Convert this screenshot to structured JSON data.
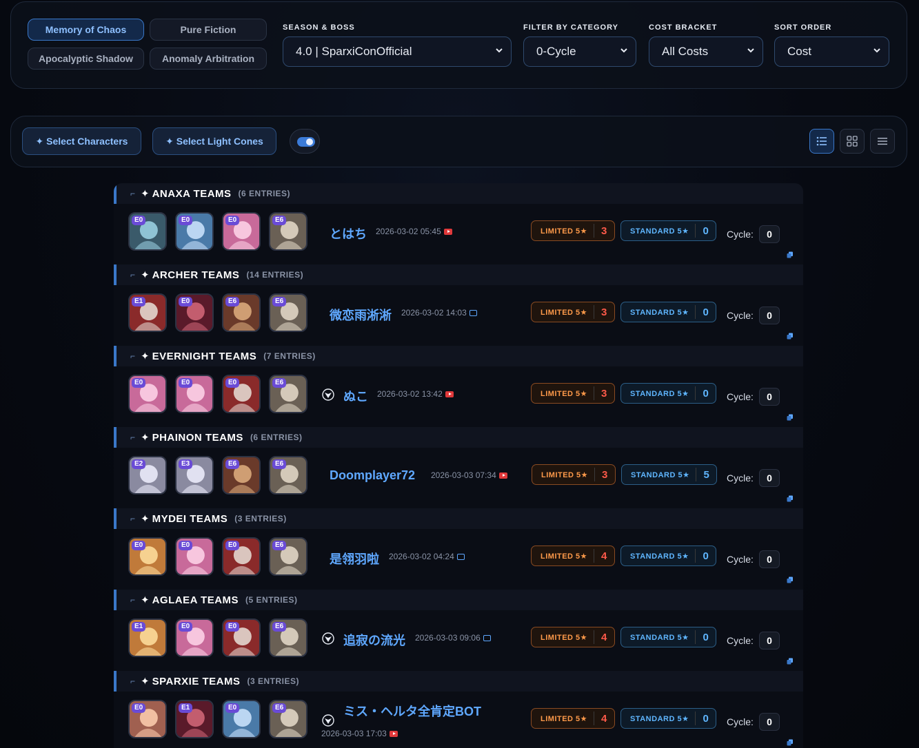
{
  "modes": [
    {
      "label": "Memory of Chaos",
      "active": true
    },
    {
      "label": "Pure Fiction",
      "active": false
    },
    {
      "label": "Apocalyptic Shadow",
      "active": false
    },
    {
      "label": "Anomaly Arbitration",
      "active": false
    }
  ],
  "filters": {
    "season": {
      "label": "SEASON & BOSS",
      "value": "4.0 | SparxiConOfficial"
    },
    "category": {
      "label": "FILTER BY CATEGORY",
      "value": "0-Cycle"
    },
    "cost": {
      "label": "COST BRACKET",
      "value": "All Costs"
    },
    "sort": {
      "label": "SORT ORDER",
      "value": "Cost"
    }
  },
  "toolbar": {
    "select_characters": "✦ Select Characters",
    "select_light_cones": "✦ Select Light Cones",
    "toggle_on": true
  },
  "labels": {
    "limited": "LIMITED 5★",
    "standard": "STANDARD 5★",
    "cycle": "Cycle:"
  },
  "groups": [
    {
      "name": "ANAXA TEAMS",
      "count": "(6 ENTRIES)",
      "entry": {
        "player": "とはち",
        "date": "2026-03-02 05:45",
        "source": "youtube",
        "verified": false,
        "eidolons": [
          "E0",
          "E0",
          "E0",
          "E6"
        ],
        "limited": "3",
        "standard": "0",
        "cycle": "0"
      }
    },
    {
      "name": "ARCHER TEAMS",
      "count": "(14 ENTRIES)",
      "entry": {
        "player": "微恋雨淅淅",
        "date": "2026-03-02 14:03",
        "source": "bilibili",
        "verified": false,
        "eidolons": [
          "E1",
          "E0",
          "E6",
          "E6"
        ],
        "limited": "3",
        "standard": "0",
        "cycle": "0"
      }
    },
    {
      "name": "EVERNIGHT TEAMS",
      "count": "(7 ENTRIES)",
      "entry": {
        "player": "ぬこ",
        "date": "2026-03-02 13:42",
        "source": "youtube",
        "verified": true,
        "eidolons": [
          "E0",
          "E0",
          "E0",
          "E6"
        ],
        "limited": "3",
        "standard": "0",
        "cycle": "0"
      }
    },
    {
      "name": "PHAINON TEAMS",
      "count": "(6 ENTRIES)",
      "entry": {
        "player": "Doomplayer72",
        "date": "2026-03-03 07:34",
        "source": "youtube",
        "verified": false,
        "eidolons": [
          "E2",
          "E3",
          "E6",
          "E6"
        ],
        "limited": "3",
        "standard": "5",
        "cycle": "0"
      }
    },
    {
      "name": "MYDEI TEAMS",
      "count": "(3 ENTRIES)",
      "entry": {
        "player": "是翎羽啦",
        "date": "2026-03-02 04:24",
        "source": "bilibili",
        "verified": false,
        "eidolons": [
          "E0",
          "E0",
          "E0",
          "E6"
        ],
        "limited": "4",
        "standard": "0",
        "cycle": "0"
      }
    },
    {
      "name": "AGLAEA TEAMS",
      "count": "(5 ENTRIES)",
      "entry": {
        "player": "追寂の流光",
        "date": "2026-03-03 09:06",
        "source": "bilibili",
        "verified": true,
        "eidolons": [
          "E1",
          "E0",
          "E0",
          "E6"
        ],
        "limited": "4",
        "standard": "0",
        "cycle": "0"
      }
    },
    {
      "name": "SPARXIE TEAMS",
      "count": "(3 ENTRIES)",
      "entry": {
        "player": "ミス・ヘルタ全肯定BOT",
        "date": "2026-03-03 17:03",
        "source": "youtube",
        "verified": true,
        "eidolons": [
          "E0",
          "E1",
          "E0",
          "E6"
        ],
        "limited": "4",
        "standard": "0",
        "cycle": "0"
      }
    }
  ]
}
